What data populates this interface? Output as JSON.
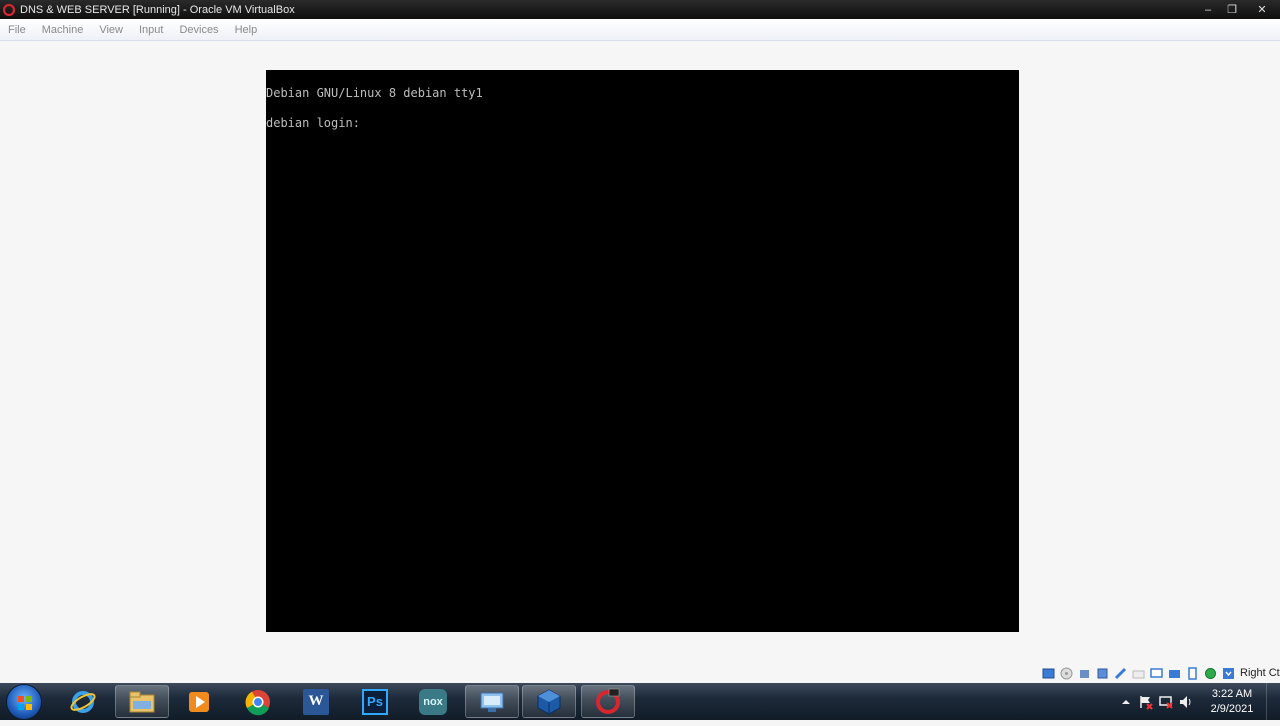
{
  "window": {
    "title": "DNS & WEB SERVER [Running] - Oracle VM VirtualBox",
    "minimize_glyph": "–",
    "restore_glyph": "❐",
    "close_glyph": "✕"
  },
  "menu": {
    "items": [
      "File",
      "Machine",
      "View",
      "Input",
      "Devices",
      "Help"
    ]
  },
  "console": {
    "line1": "Debian GNU/Linux 8 debian tty1",
    "line2": "debian login:"
  },
  "statusbar": {
    "host_key": "Right Ctrl",
    "icons": [
      "hard-disk-icon",
      "optical-drive-icon",
      "audio-icon",
      "network-icon",
      "usb-icon",
      "shared-folders-icon",
      "display-icon",
      "video-capture-icon",
      "cpu-icon",
      "mouse-integration-icon",
      "keyboard-icon"
    ]
  },
  "taskbar": {
    "apps": [
      "internet-explorer-icon",
      "file-explorer-icon",
      "media-player-icon",
      "chrome-icon",
      "word-icon",
      "photoshop-icon",
      "nox-icon",
      "control-panel-icon",
      "virtualbox-icon",
      "debian-icon"
    ],
    "photoshop_label": "Ps",
    "word_label": "W",
    "nox_label": "nox"
  },
  "clock": {
    "time": "3:22 AM",
    "date": "2/9/2021"
  },
  "colors": {
    "console_bg": "#000000",
    "console_text": "#bdbdbd",
    "taskbar": "#1d2a3a"
  }
}
